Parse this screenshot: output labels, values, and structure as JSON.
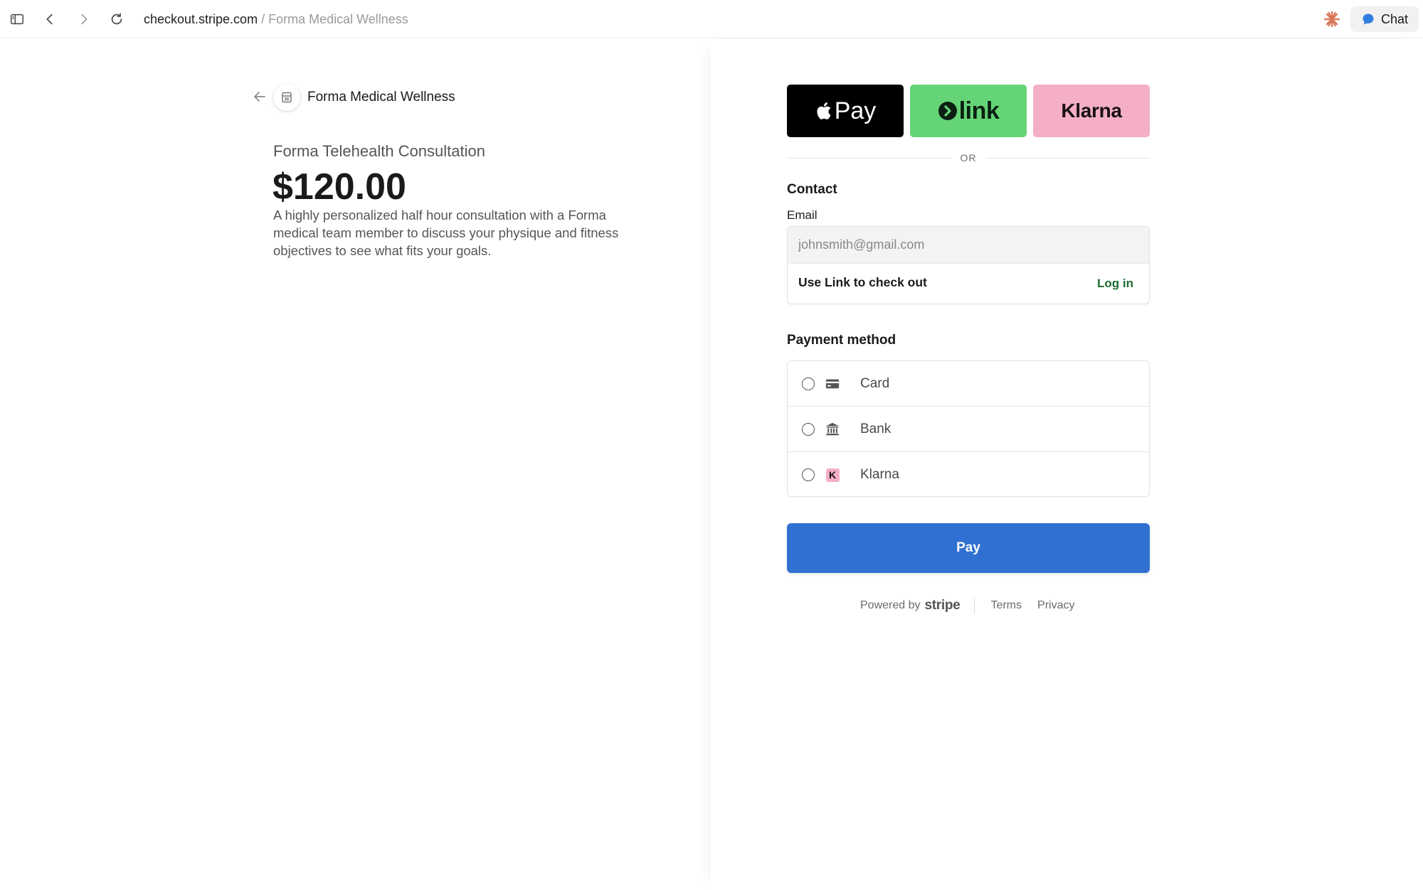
{
  "browser": {
    "url_host": "checkout.stripe.com",
    "url_path": " / Forma Medical Wellness",
    "chat_label": "Chat",
    "icons": [
      "sidebar-icon",
      "back-icon",
      "forward-icon",
      "reload-icon",
      "claude-icon",
      "chat-bubble-icon"
    ]
  },
  "merchant": {
    "name": "Forma Medical Wellness"
  },
  "product": {
    "name": "Forma Telehealth Consultation",
    "price": "$120.00",
    "description": "A highly personalized half hour consultation with a Forma medical team member to discuss your physique and fitness objectives to see what fits your goals."
  },
  "wallets": {
    "apple_pay": "Pay",
    "link": "link",
    "klarna": "Klarna"
  },
  "divider": "OR",
  "contact": {
    "title": "Contact",
    "email_label": "Email",
    "email_placeholder": "johnsmith@gmail.com",
    "use_link": "Use Link to check out",
    "login": "Log in"
  },
  "payment": {
    "title": "Payment method",
    "methods": [
      {
        "label": "Card",
        "icon": "card-icon"
      },
      {
        "label": "Bank",
        "icon": "bank-icon"
      },
      {
        "label": "Klarna",
        "icon": "klarna-icon",
        "badge": "K"
      }
    ]
  },
  "pay_button": "Pay",
  "footer": {
    "powered_by": "Powered by",
    "brand": "stripe",
    "terms": "Terms",
    "privacy": "Privacy"
  },
  "colors": {
    "pay_button": "#3070d0",
    "link_green": "#65d476",
    "klarna_pink": "#f5aec8",
    "login_green": "#1d6b2f"
  }
}
